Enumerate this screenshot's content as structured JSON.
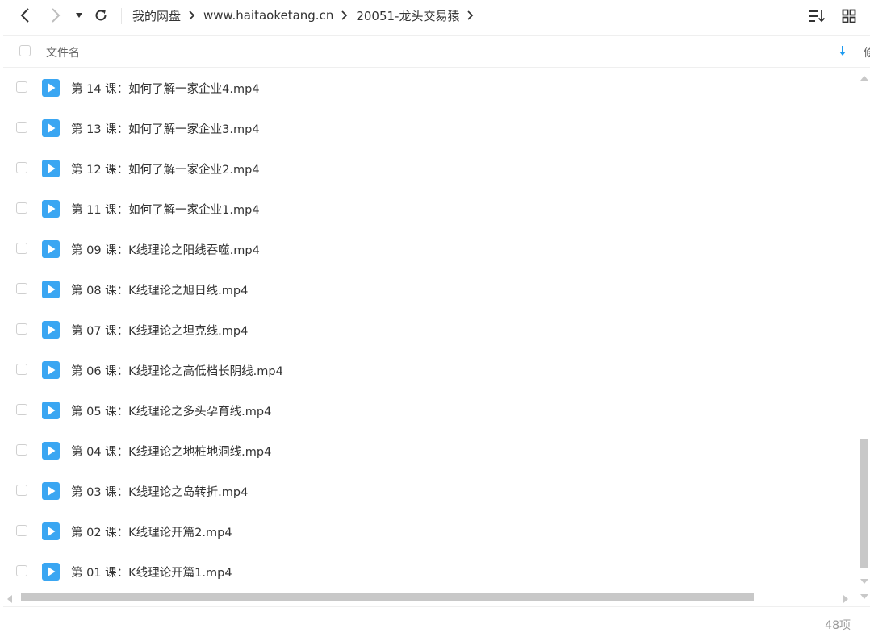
{
  "toolbar": {
    "breadcrumb": [
      "我的网盘",
      "www.haitaoketang.cn",
      "20051-龙头交易猿"
    ],
    "icons": [
      "chevron-left-icon",
      "chevron-right-icon",
      "dropdown-icon",
      "refresh-icon",
      "sort-list-icon",
      "grid-view-icon"
    ]
  },
  "header": {
    "name_label": "文件名",
    "second_column_label": "修"
  },
  "files": [
    {
      "name": "第 14 课：如何了解一家企业4.mp4"
    },
    {
      "name": "第 13 课：如何了解一家企业3.mp4"
    },
    {
      "name": "第 12 课：如何了解一家企业2.mp4"
    },
    {
      "name": "第 11 课：如何了解一家企业1.mp4"
    },
    {
      "name": "第 09 课：K线理论之阳线吞噬.mp4"
    },
    {
      "name": "第 08 课：K线理论之旭日线.mp4"
    },
    {
      "name": "第 07 课：K线理论之坦克线.mp4"
    },
    {
      "name": "第 06 课：K线理论之高低档长阴线.mp4"
    },
    {
      "name": "第 05 课：K线理论之多头孕育线.mp4"
    },
    {
      "name": "第 04 课：K线理论之地桩地洞线.mp4"
    },
    {
      "name": "第 03 课：K线理论之岛转折.mp4"
    },
    {
      "name": "第 02 课：K线理论开篇2.mp4"
    },
    {
      "name": "第 01 课：K线理论开篇1.mp4"
    }
  ],
  "footer": {
    "item_count": "48项"
  },
  "colors": {
    "accent": "#1e9bf0",
    "video_icon": "#3aa6f2",
    "text": "#333333",
    "muted": "#999999"
  }
}
